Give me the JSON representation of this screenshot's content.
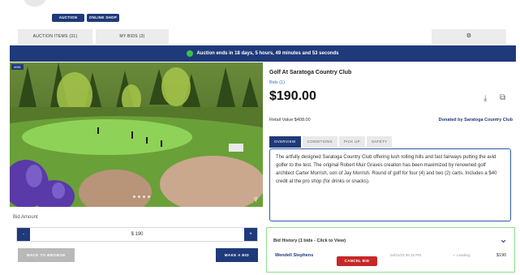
{
  "header": {
    "faint_text": "",
    "auction_label": "AUCTION",
    "online_shop_label": "ONLINE SHOP"
  },
  "main_tabs": {
    "items_label": "AUCTION ITEMS (31)",
    "bids_label": "MY BIDS (3)",
    "gear_icon": "⚙"
  },
  "banner": {
    "text": "Auction ends in 18 days, 5 hours, 49 minutes and 53 seconds",
    "dot_color": "#39c24a"
  },
  "photo": {
    "badge": "#061",
    "alt_description": "golf course photo"
  },
  "item": {
    "title": "Golf At Saratoga Country Club",
    "bids": "Bids (1)",
    "price": "$190.00",
    "retail": "Retail Value $408.00",
    "donated": "Donated by Saratoga Country Club"
  },
  "sub_tabs": [
    "OVERVIEW",
    "CONDITIONS",
    "PICK UP",
    "SAFETY"
  ],
  "description": "The artfully designed Saratoga Country Club offering lush rolling hills and fast fairways putting the avid golfer to the test. The original Robert Muir Graves creation has been maximized by renowned golf architect Carter Morrish, son of Jay Morrish. Round of golf for four (4) and two (2) carts. Includes a $40 credit at the pro shop (for drinks or snacks).",
  "bid_form": {
    "label": "Bid Amount",
    "minus": "-",
    "plus": "+",
    "value": "$ 190",
    "back_label": "BACK TO BROWSE",
    "make_label": "MAKE A BID"
  },
  "history": {
    "title": "Bid History (1 bids - Click to View)",
    "bidder": "Wendell Stephens",
    "cancel_label": "CANCEL BID",
    "time": "04/21/23 06:15 PM",
    "status": "✓ Leading",
    "amount": "$190"
  },
  "colors": {
    "brand": "#1f3a7a",
    "cancel": "#c62828",
    "history_border": "#8ce08c"
  }
}
